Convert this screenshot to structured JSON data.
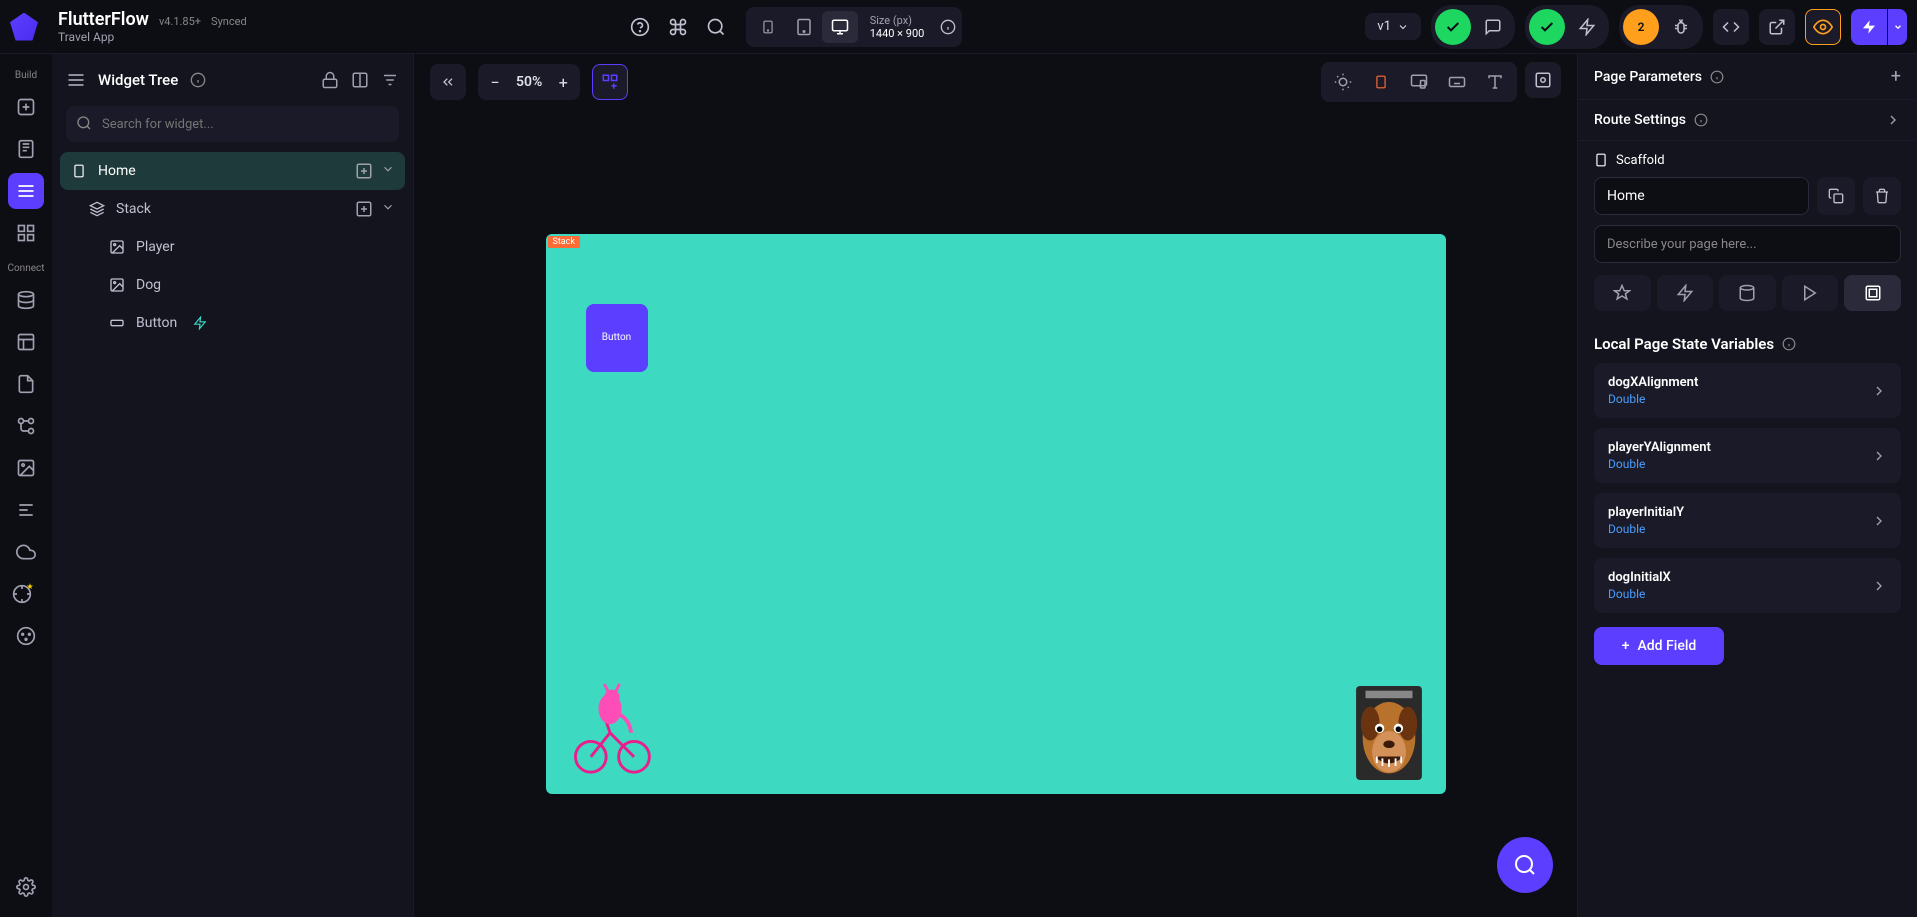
{
  "header": {
    "project_name": "FlutterFlow",
    "version": "v4.1.85+",
    "sync_status": "Synced",
    "app_name": "Travel App"
  },
  "device": {
    "size_label": "Size (px)",
    "dimensions": "1440 × 900"
  },
  "version_selector": "v1",
  "issues_badge": "2",
  "zoom": "50%",
  "left_panel": {
    "title": "Widget Tree",
    "search_placeholder": "Search for widget...",
    "tree": {
      "page": "Home",
      "stack": "Stack",
      "player": "Player",
      "dog": "Dog",
      "button": "Button"
    }
  },
  "canvas": {
    "stack_tag": "Stack",
    "button_label": "Button"
  },
  "right_panel": {
    "page_params": "Page Parameters",
    "route_settings": "Route Settings",
    "scaffold": "Scaffold",
    "page_name": "Home",
    "desc_placeholder": "Describe your page here...",
    "vars_title": "Local Page State Variables",
    "vars": [
      {
        "name": "dogXAlignment",
        "type": "Double"
      },
      {
        "name": "playerYAlignment",
        "type": "Double"
      },
      {
        "name": "playerInitialY",
        "type": "Double"
      },
      {
        "name": "dogInitialX",
        "type": "Double"
      }
    ],
    "add_field": "Add Field"
  },
  "rail": {
    "build": "Build",
    "connect": "Connect"
  }
}
